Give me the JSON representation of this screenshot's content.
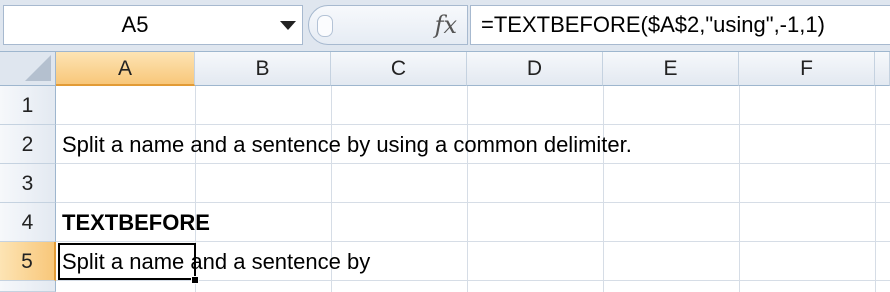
{
  "name_box": {
    "value": "A5"
  },
  "formula_bar": {
    "fx_icon": "fx-icon",
    "formula": "=TEXTBEFORE($A$2,\"using\",-1,1)"
  },
  "columns": [
    "A",
    "B",
    "C",
    "D",
    "E",
    "F"
  ],
  "rows": [
    "1",
    "2",
    "3",
    "4",
    "5"
  ],
  "cells": {
    "A2": "Split a name and a sentence by using a common delimiter.",
    "A4": "TEXTBEFORE",
    "A5": "Split a name and a sentence by"
  },
  "active": {
    "column": "A",
    "row": "5"
  },
  "colors": {
    "active_header": "#f8c77a",
    "header_bg": "#e3e9f1",
    "grid_line": "#d6dde6"
  }
}
